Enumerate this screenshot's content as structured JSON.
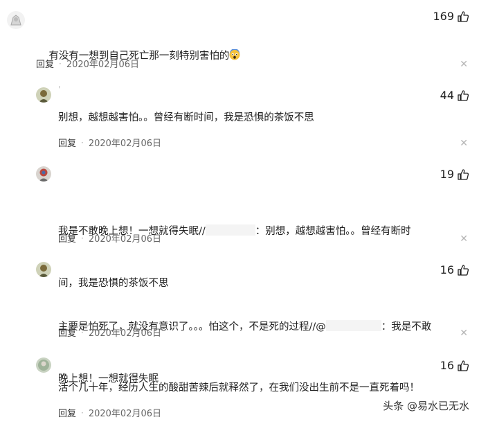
{
  "comments": [
    {
      "username": "",
      "likes": "169",
      "text": "有没有一想到自己死亡那一刻特别害怕的",
      "emoji": "scared-face-emoji",
      "reply_label": "回复",
      "date": "2020年02月06日"
    },
    {
      "username": "'",
      "likes": "44",
      "text": "别想，越想越害怕。。曾经有断时间，我是恐惧的茶饭不思",
      "reply_label": "回复",
      "date": "2020年02月06日"
    },
    {
      "username": "",
      "likes": "19",
      "text_line1_a": "我是不敢晚上想！一想就得失眠//",
      "text_line1_b": "：别想，越想越害怕。。曾经有断时",
      "text_line2": "间，我是恐惧的茶饭不思",
      "reply_label": "回复",
      "date": "2020年02月06日"
    },
    {
      "username": "",
      "likes": "16",
      "text_line1_a": "主要是怕死了，就没有意识了。。。怕这个，不是死的过程//@",
      "text_line1_b": "：我是不敢",
      "text_line2": "晚上想！一想就得失眠",
      "reply_label": "回复",
      "date": "2020年02月06日"
    },
    {
      "username": "",
      "likes": "16",
      "text": "活个几十年，经历人生的酸甜苦辣后就释然了，在我们没出生前不是一直死着吗！",
      "reply_label": "回复",
      "date": "2020年02月06日"
    }
  ],
  "separator": "·",
  "close_symbol": "✕",
  "watermark": "头条 @易水已无水",
  "icons": {
    "like": "thumbs-up-icon",
    "close": "close-icon"
  },
  "colors": {
    "text": "#222222",
    "meta": "#666666",
    "close": "#b5b5b5"
  }
}
